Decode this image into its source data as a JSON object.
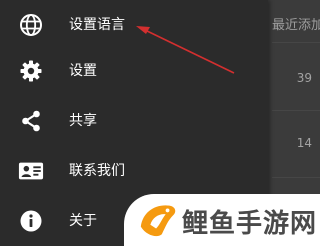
{
  "background_list": {
    "header_text": "最近添加",
    "values": [
      "39",
      "14"
    ]
  },
  "drawer": {
    "items": [
      {
        "label": "设置语言",
        "icon": "globe-icon"
      },
      {
        "label": "设置",
        "icon": "gear-icon"
      },
      {
        "label": "共享",
        "icon": "share-icon"
      },
      {
        "label": "联系我们",
        "icon": "contact-card-icon"
      },
      {
        "label": "关于",
        "icon": "info-icon"
      }
    ]
  },
  "watermark": {
    "text": "鲤鱼手游网"
  },
  "colors": {
    "drawer_background": "#2b2b2b",
    "app_background": "#3b3b3b",
    "annotation_arrow": "#d32f2f",
    "watermark_fish": "#f59a10"
  }
}
